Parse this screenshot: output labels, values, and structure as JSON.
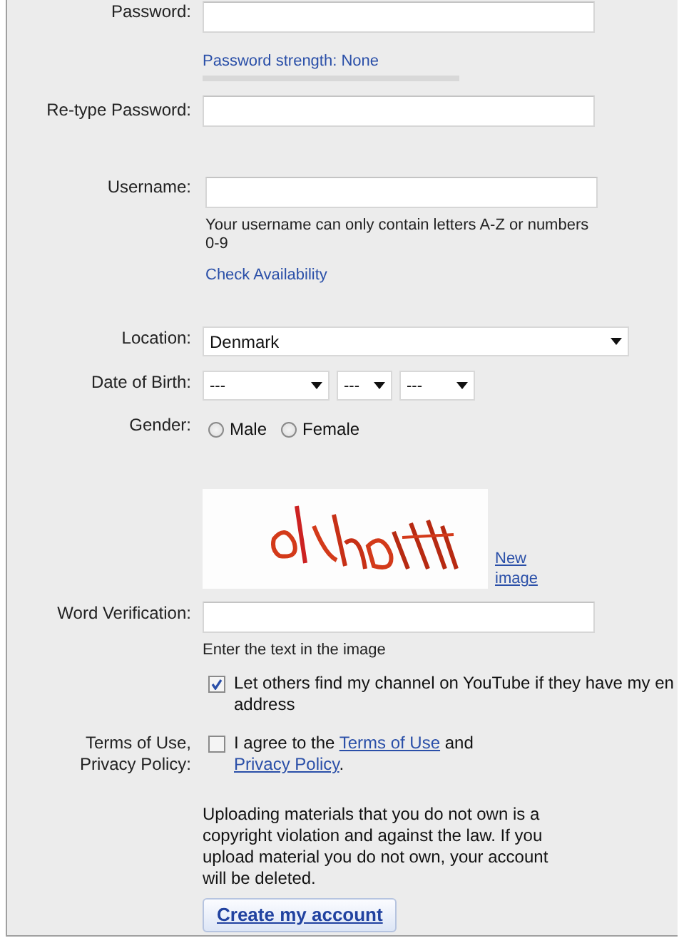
{
  "form": {
    "password": {
      "label": "Password:"
    },
    "password_strength": {
      "text": "Password strength: None",
      "level": 0
    },
    "retype_password": {
      "label": "Re-type Password:"
    },
    "username": {
      "label": "Username:",
      "hint": "Your username can only contain letters A-Z or numbers 0-9",
      "link": "Check Availability"
    },
    "location": {
      "label": "Location:",
      "value": "Denmark"
    },
    "date_of_birth": {
      "label": "Date of Birth:",
      "selects": [
        "---",
        "---",
        "---"
      ]
    },
    "gender": {
      "label": "Gender:",
      "options": [
        {
          "label": "Male",
          "selected": false
        },
        {
          "label": "Female",
          "selected": false
        }
      ]
    },
    "captcha": {
      "link": "New image"
    },
    "word_verification": {
      "label": "Word Verification:",
      "hint": "Enter the text in the image"
    },
    "find_channel": {
      "lines": [
        "Let others find my channel on YouTube if they have my en",
        "address"
      ],
      "checked": true
    },
    "terms": {
      "label": "Terms of Use, Privacy Policy:",
      "text_before": "I agree to the",
      "link_terms": "Terms of Use",
      "text_middle": "and",
      "link_privacy": "Privacy Policy",
      "text_end": ".",
      "checked": false
    },
    "notice": "Uploading materials that you do not own is a copyright violation and against the law. If you upload material you do not own, your account will be deleted.",
    "submit": "Create my account"
  }
}
